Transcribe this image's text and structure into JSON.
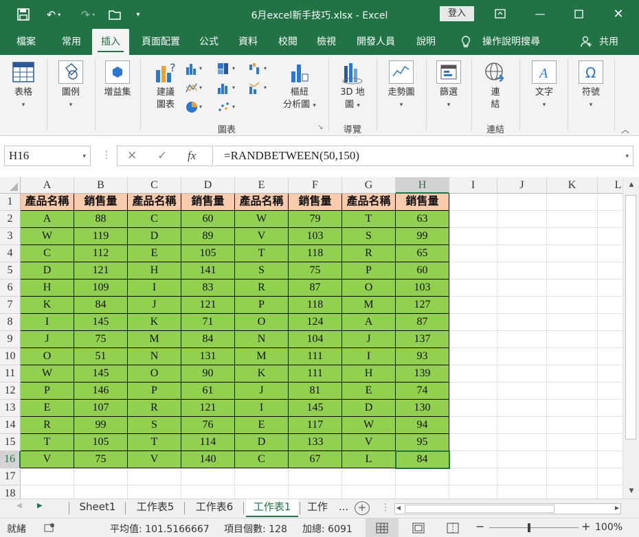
{
  "window": {
    "title": "6月excel新手技巧.xlsx  -  Excel",
    "login_label": "登入",
    "accent": "#217346"
  },
  "tabs": [
    {
      "label": "檔案"
    },
    {
      "label": "常用"
    },
    {
      "label": "插入"
    },
    {
      "label": "頁面配置"
    },
    {
      "label": "公式"
    },
    {
      "label": "資料"
    },
    {
      "label": "校閱"
    },
    {
      "label": "檢視"
    },
    {
      "label": "開發人員"
    },
    {
      "label": "說明"
    },
    {
      "label": "操作說明搜尋"
    },
    {
      "label": "共用"
    }
  ],
  "ribbon": {
    "table": "表格",
    "illustrations": "圖例",
    "addins": "增益集",
    "recommended_line1": "建議",
    "recommended_line2": "圖表",
    "pivot_line1": "樞紐",
    "pivot_line2": "分析圖",
    "map3d_line1": "3D 地",
    "map3d_line2": "圖",
    "sparkline": "走勢圖",
    "filter": "篩選",
    "link_line1": "連",
    "link_line2": "結",
    "text": "文字",
    "symbol": "符號",
    "group_charts": "圖表",
    "group_tours": "導覽",
    "group_links": "連結"
  },
  "formula_bar": {
    "name_box": "H16",
    "cancel": "✕",
    "enter": "✓",
    "fx": "fx",
    "formula": "=RANDBETWEEN(50,150)"
  },
  "grid": {
    "columns": [
      "A",
      "B",
      "C",
      "D",
      "E",
      "F",
      "G",
      "H",
      "I",
      "J",
      "K",
      "L"
    ],
    "rows": [
      "1",
      "2",
      "3",
      "4",
      "5",
      "6",
      "7",
      "8",
      "9",
      "10",
      "11",
      "12",
      "13",
      "14",
      "15",
      "16",
      "17",
      "18"
    ],
    "header_row": [
      "產品名稱",
      "銷售量",
      "產品名稱",
      "銷售量",
      "產品名稱",
      "銷售量",
      "產品名稱",
      "銷售量"
    ],
    "data": [
      [
        "A",
        "88",
        "C",
        "60",
        "W",
        "79",
        "T",
        "63"
      ],
      [
        "W",
        "119",
        "D",
        "89",
        "V",
        "103",
        "S",
        "99"
      ],
      [
        "C",
        "112",
        "E",
        "105",
        "T",
        "118",
        "R",
        "65"
      ],
      [
        "D",
        "121",
        "H",
        "141",
        "S",
        "75",
        "P",
        "60"
      ],
      [
        "H",
        "109",
        "I",
        "83",
        "R",
        "87",
        "O",
        "103"
      ],
      [
        "K",
        "84",
        "J",
        "121",
        "P",
        "118",
        "M",
        "127"
      ],
      [
        "I",
        "145",
        "K",
        "71",
        "O",
        "124",
        "A",
        "87"
      ],
      [
        "J",
        "75",
        "M",
        "84",
        "N",
        "104",
        "J",
        "137"
      ],
      [
        "O",
        "51",
        "N",
        "131",
        "M",
        "111",
        "I",
        "93"
      ],
      [
        "W",
        "145",
        "O",
        "90",
        "K",
        "111",
        "H",
        "139"
      ],
      [
        "P",
        "146",
        "P",
        "61",
        "J",
        "81",
        "E",
        "74"
      ],
      [
        "E",
        "107",
        "R",
        "121",
        "I",
        "145",
        "D",
        "130"
      ],
      [
        "R",
        "99",
        "S",
        "76",
        "E",
        "117",
        "W",
        "94"
      ],
      [
        "T",
        "105",
        "T",
        "114",
        "D",
        "133",
        "V",
        "95"
      ],
      [
        "V",
        "75",
        "V",
        "140",
        "C",
        "67",
        "L",
        "84"
      ]
    ],
    "header_color": "#f8cbad",
    "data_color": "#92d050"
  },
  "sheets": [
    "Sheet1",
    "工作表5",
    "工作表6",
    "工作表1",
    "工作"
  ],
  "sheets_more": "...",
  "status": {
    "ready": "就緒",
    "average": "平均值: 101.5166667",
    "count": "項目個數: 128",
    "sum": "加總: 6091",
    "zoom": "100%"
  }
}
